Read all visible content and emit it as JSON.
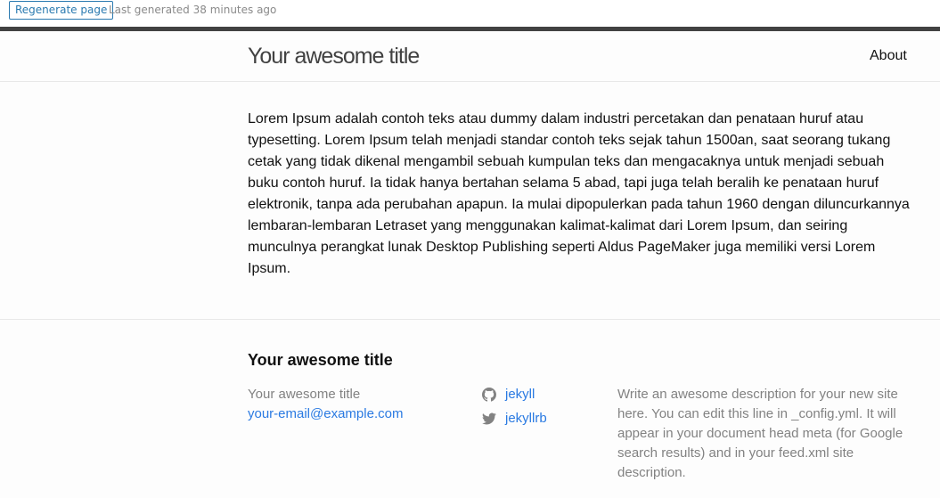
{
  "toolbar": {
    "regenerate_label": "Regenerate page",
    "last_generated": "Last generated 38 minutes ago"
  },
  "header": {
    "site_title": "Your awesome title",
    "nav": [
      {
        "label": "About"
      }
    ]
  },
  "main": {
    "paragraph": "Lorem Ipsum adalah contoh teks atau dummy dalam industri percetakan dan penataan huruf atau typesetting. Lorem Ipsum telah menjadi standar contoh teks sejak tahun 1500an, saat seorang tukang cetak yang tidak dikenal mengambil sebuah kumpulan teks dan mengacaknya untuk menjadi sebuah buku contoh huruf. Ia tidak hanya bertahan selama 5 abad, tapi juga telah beralih ke penataan huruf elektronik, tanpa ada perubahan apapun. Ia mulai dipopulerkan pada tahun 1960 dengan diluncurkannya lembaran-lembaran Letraset yang menggunakan kalimat-kalimat dari Lorem Ipsum, dan seiring munculnya perangkat lunak Desktop Publishing seperti Aldus PageMaker juga memiliki versi Lorem Ipsum."
  },
  "footer": {
    "heading": "Your awesome title",
    "site_name": "Your awesome title",
    "email": "your-email@example.com",
    "social": [
      {
        "icon": "github-icon",
        "label": "jekyll"
      },
      {
        "icon": "twitter-icon",
        "label": "jekyllrb"
      }
    ],
    "description": "Write an awesome description for your new site here. You can edit this line in _config.yml. It will appear in your document head meta (for Google search results) and in your feed.xml site description."
  },
  "colors": {
    "link": "#2a7ae2",
    "header_border": "#424242",
    "muted_text": "#828282",
    "regen_button": "#2a7ab0"
  }
}
